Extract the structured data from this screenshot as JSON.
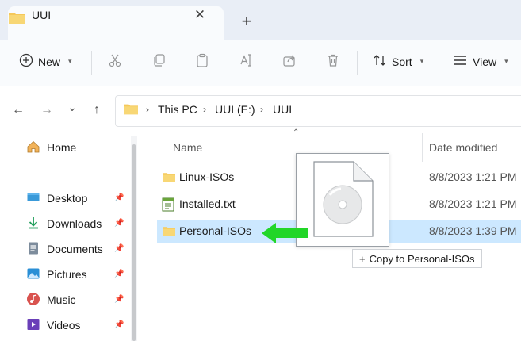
{
  "tab": {
    "title": "UUI",
    "close_glyph": "✕",
    "new_tab_glyph": "+"
  },
  "toolbar": {
    "new_label": "New",
    "sort_label": "Sort",
    "view_label": "View",
    "icons": [
      "plus-circle-icon",
      "cut-icon",
      "copy-icon",
      "paste-icon",
      "rename-icon",
      "share-icon",
      "delete-icon",
      "sort-icon",
      "view-icon"
    ]
  },
  "navigation": {
    "back": "←",
    "forward": "→",
    "recent": "⌄",
    "up": "↑"
  },
  "address": {
    "crumbs": [
      "This PC",
      "UUI (E:)",
      "UUI"
    ],
    "separator": "›"
  },
  "sidebar": {
    "home": "Home",
    "items": [
      {
        "label": "Desktop",
        "icon": "desktop-icon"
      },
      {
        "label": "Downloads",
        "icon": "downloads-icon"
      },
      {
        "label": "Documents",
        "icon": "documents-icon"
      },
      {
        "label": "Pictures",
        "icon": "pictures-icon"
      },
      {
        "label": "Music",
        "icon": "music-icon"
      },
      {
        "label": "Videos",
        "icon": "videos-icon"
      }
    ]
  },
  "files": {
    "columns": {
      "name": "Name",
      "date": "Date modified"
    },
    "rows": [
      {
        "name": "Linux-ISOs",
        "date": "8/8/2023 1:21 PM",
        "type": "folder"
      },
      {
        "name": "Installed.txt",
        "date": "8/8/2023 1:21 PM",
        "type": "text-file"
      },
      {
        "name": "Personal-ISOs",
        "date": "8/8/2023 1:39 PM",
        "type": "folder",
        "selected": true
      }
    ]
  },
  "drag": {
    "tooltip": "Copy to Personal-ISOs",
    "plus_glyph": "+"
  },
  "colors": {
    "accent": "#0067c0",
    "selection": "#cce8ff",
    "folder": "#f5c85a",
    "arrow": "#22d628",
    "tabstrip": "#e9eef6"
  }
}
